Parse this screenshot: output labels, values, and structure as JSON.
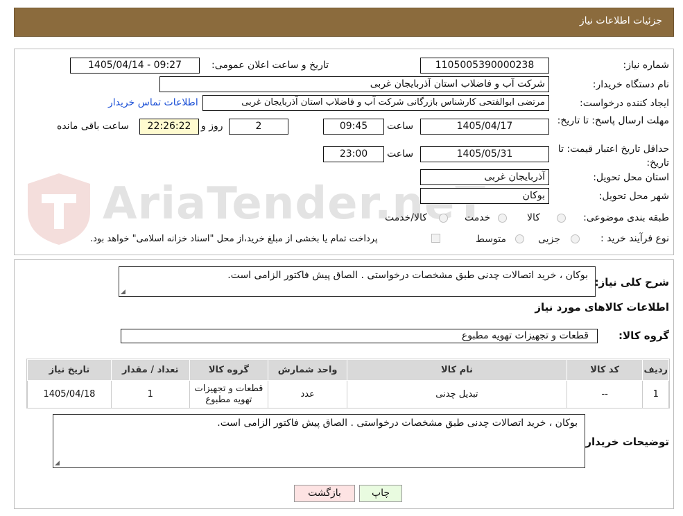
{
  "header": {
    "title": "جزئیات اطلاعات نیاز"
  },
  "form": {
    "need_number_label": "شماره نیاز:",
    "need_number": "1105005390000238",
    "announce_label": "تاریخ و ساعت اعلان عمومی:",
    "announce_value": "1405/04/14 - 09:27",
    "buyer_label": "نام دستگاه خریدار:",
    "buyer_value": "شرکت آب و فاضلاب استان آذربایجان غربی",
    "creator_label": "ایجاد کننده درخواست:",
    "creator_value": "مرتضی ابوالفتحی کارشناس بازرگانی شرکت آب و فاضلاب استان آذربایجان غربی",
    "contact_link": "اطلاعات تماس خریدار",
    "deadline_label": "مهلت ارسال پاسخ: تا تاریخ:",
    "deadline_date": "1405/04/17",
    "time_label": "ساعت",
    "deadline_time": "09:45",
    "days_value": "2",
    "days_label": "روز و",
    "remaining_time": "22:26:22",
    "remaining_label": "ساعت باقی مانده",
    "validity_label": "حداقل تاریخ اعتبار قیمت: تا تاریخ:",
    "validity_date": "1405/05/31",
    "validity_time": "23:00",
    "province_label": "استان محل تحویل:",
    "province_value": "آذربایجان غربی",
    "city_label": "شهر محل تحویل:",
    "city_value": "بوکان",
    "category_label": "طبقه بندی موضوعی:",
    "category_options": [
      "کالا",
      "خدمت",
      "کالا/خدمت"
    ],
    "process_label": "نوع فرآیند خرید :",
    "process_options": [
      "جزیی",
      "متوسط"
    ],
    "payment_note": "پرداخت تمام یا بخشی از مبلغ خرید،از محل \"اسناد خزانه اسلامی\" خواهد بود."
  },
  "details": {
    "description_label": "شرح کلی نیاز:",
    "description_value": "بوکان ، خرید اتصالات چدنی طبق مشخصات درخواستی . الصاق پیش فاکتور الزامی است.",
    "items_info_title": "اطلاعات کالاهای مورد نیاز",
    "group_label": "گروه کالا:",
    "group_value": "قطعات و تجهیزات تهویه مطبوع",
    "table": {
      "headers": [
        "ردیف",
        "کد کالا",
        "نام کالا",
        "واحد شمارش",
        "گروه کالا",
        "تعداد / مقدار",
        "تاریخ نیاز"
      ],
      "rows": [
        [
          "1",
          "--",
          "تبدیل چدنی",
          "عدد",
          "قطعات و تجهیزات تهویه مطبوع",
          "1",
          "1405/04/18"
        ]
      ]
    },
    "buyer_notes_label": "توضیحات خریدار:",
    "buyer_notes_value": "بوکان ، خرید اتصالات چدنی طبق مشخصات درخواستی . الصاق پیش فاکتور الزامی است."
  },
  "buttons": {
    "print": "چاپ",
    "back": "بازگشت"
  },
  "watermark": {
    "text": "AriaTender.neT"
  },
  "colors": {
    "header_bg": "#8b6b3d",
    "remaining_bg": "#fffbd0",
    "print_bg": "#e9fbe0",
    "back_bg": "#fde3e3",
    "link": "#1a4fd6"
  }
}
